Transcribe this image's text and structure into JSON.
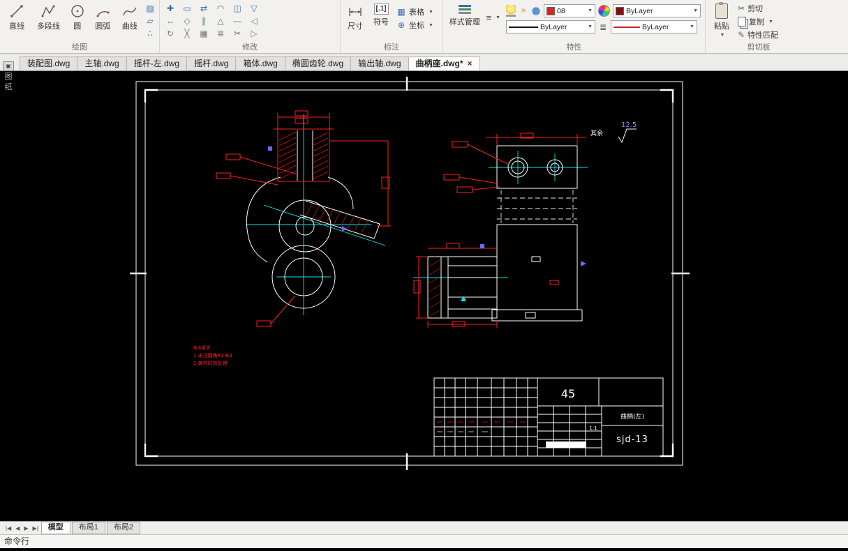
{
  "ribbon": {
    "draw": {
      "label": "绘图",
      "tools": [
        "直线",
        "多段线",
        "圆",
        "圆弧",
        "曲线"
      ]
    },
    "modify": {
      "label": "修改",
      "icons": [
        "✚",
        "↔",
        "↻",
        "▭",
        "◇",
        "╳",
        "⇄",
        "∥",
        "▦",
        "◠",
        "△",
        "≣",
        "◫",
        "—",
        "✂",
        "▽",
        "◁",
        "▷"
      ]
    },
    "annotate": {
      "label": "标注",
      "dim": "尺寸",
      "symbol": "符号",
      "symbol_icon": "[.1]",
      "table": "表格",
      "coord": "坐标"
    },
    "properties": {
      "label": "特性",
      "style_manager": "样式管理",
      "color_value": "08",
      "layer_value": "ByLayer",
      "lineweight_value": "ByLayer",
      "linecolor_value": "ByLayer"
    },
    "clipboard": {
      "label": "剪切板",
      "paste": "粘贴",
      "cut": "剪切",
      "copy": "复制",
      "match": "特性匹配"
    }
  },
  "file_tabs": {
    "items": [
      "装配图.dwg",
      "主轴.dwg",
      "摇杆-左.dwg",
      "摇杆.dwg",
      "箱体.dwg",
      "椭圆齿轮.dwg",
      "输出轴.dwg",
      "曲柄座.dwg*"
    ],
    "close_glyph": "×"
  },
  "side_palette": {
    "icon": "▣",
    "chars": [
      "图",
      "纸"
    ]
  },
  "drawing": {
    "roughness_prefix": "其余",
    "roughness_value": "12.5",
    "notes": [
      "技术要求",
      "1 未注圆角R1-R3",
      "2 铸件时效处理"
    ],
    "title_block": {
      "material": "45",
      "part_name": "曲柄(左)",
      "code": "sjd-13",
      "scale": "1:1"
    }
  },
  "layout_tabs": {
    "items": [
      "模型",
      "布局1",
      "布局2"
    ],
    "nav": [
      "|◀",
      "◀",
      "▶",
      "▶|"
    ]
  },
  "command_line": "命令行"
}
